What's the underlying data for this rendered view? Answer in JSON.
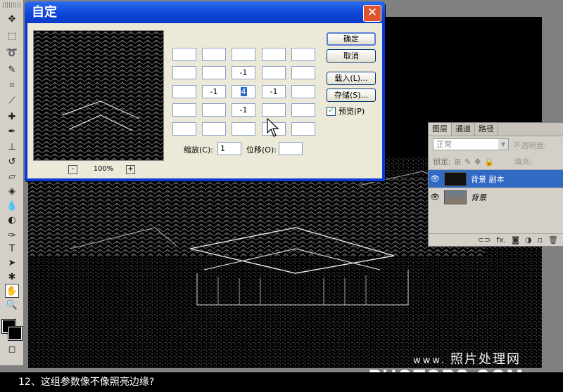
{
  "dialog": {
    "title": "自定",
    "close_glyph": "✕",
    "zoom": {
      "minus": "-",
      "level": "100%",
      "plus": "+"
    },
    "kernel": [
      [
        "",
        "",
        "",
        "",
        ""
      ],
      [
        "",
        "",
        "-1",
        "",
        ""
      ],
      [
        "",
        "-1",
        "4",
        "-1",
        ""
      ],
      [
        "",
        "",
        "-1",
        "",
        ""
      ],
      [
        "",
        "",
        "",
        "",
        ""
      ]
    ],
    "scale_label": "缩放(C):",
    "scale_value": "1",
    "offset_label": "位移(O):",
    "offset_value": "",
    "buttons": {
      "ok": "确定",
      "cancel": "取消",
      "load": "载入(L)...",
      "save": "存储(S)..."
    },
    "preview_label": "预览(P)",
    "preview_checked": true
  },
  "layers_panel": {
    "tabs": [
      "图层",
      "通道",
      "路径"
    ],
    "blend_mode": "正常",
    "opacity_label": "不透明度:",
    "lock_label": "锁定:",
    "fill_label": "填充:",
    "layers": [
      {
        "name": "背景 副本",
        "selected": true
      },
      {
        "name": "背景",
        "selected": false
      }
    ],
    "footer_icons": [
      "link-icon",
      "fx-icon",
      "mask-icon",
      "adjustment-icon",
      "new-layer-icon",
      "trash-icon"
    ],
    "fx_text": "fx."
  },
  "watermark": {
    "www": "www.",
    "cn": "照片处理网",
    "brand": "PHOTOPS.COM"
  },
  "caption": "12、这组参数像不像照亮边缘?",
  "toolbar": {
    "tools": [
      "move-tool",
      "marquee-tool",
      "lasso-tool",
      "quick-select-tool",
      "crop-tool",
      "eyedropper-tool",
      "healing-tool",
      "brush-tool",
      "stamp-tool",
      "history-brush-tool",
      "eraser-tool",
      "bucket-tool",
      "blur-tool",
      "dodge-tool",
      "pen-tool",
      "type-tool",
      "path-select-tool",
      "shape-tool",
      "hand-tool",
      "zoom-tool"
    ],
    "selected_tool": "hand-tool"
  }
}
